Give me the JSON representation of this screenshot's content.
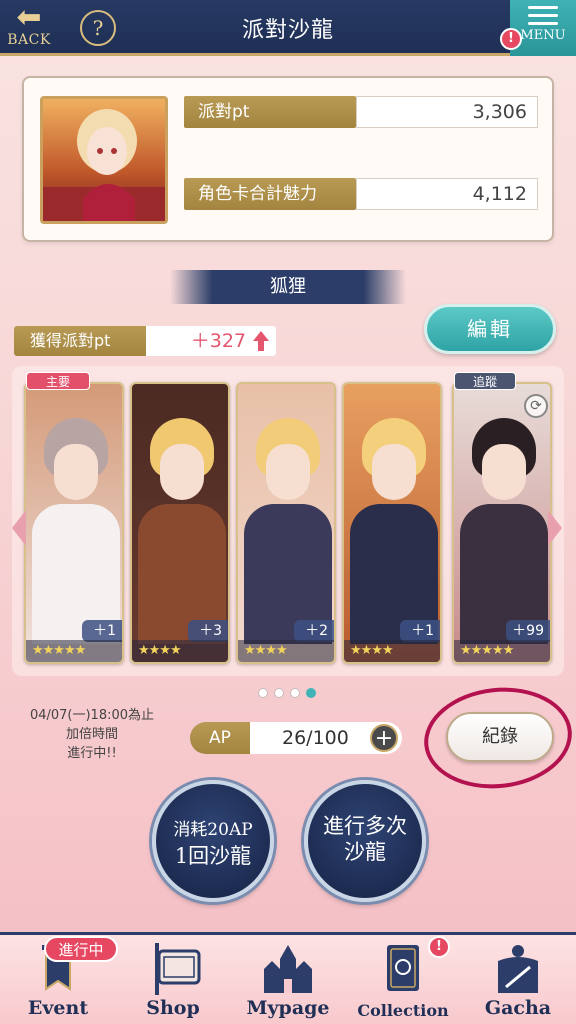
{
  "header": {
    "back_label": "BACK",
    "help_label": "?",
    "title": "派對沙龍",
    "menu_label": "MENU",
    "menu_badge": "!"
  },
  "stats": {
    "party_pt_label": "派對pt",
    "party_pt_value": "3,306",
    "charm_label": "角色卡合計魅力",
    "charm_value": "4,112"
  },
  "character_name": "狐狸",
  "edit_label": "編輯",
  "gain": {
    "label": "獲得派對pt",
    "value": "＋327"
  },
  "cards": [
    {
      "plus": "＋1",
      "stars": "★★★★★",
      "tag": "主要"
    },
    {
      "plus": "＋3",
      "stars": "★★★★"
    },
    {
      "plus": "＋2",
      "stars": "★★★★"
    },
    {
      "plus": "＋1",
      "stars": "★★★★"
    },
    {
      "plus": "＋99",
      "stars": "★★★★★",
      "tag": "追蹤"
    }
  ],
  "pager": {
    "total": 4,
    "active": 4
  },
  "event_note": {
    "line1": "04/07(一)18:00為止",
    "line2": "加倍時間",
    "line3": "進行中!!"
  },
  "ap": {
    "label": "AP",
    "value": "26/100",
    "plus": "+"
  },
  "record_label": "紀錄",
  "actions": {
    "single_line1": "消耗20AP",
    "single_line2": "1回沙龍",
    "multi_line1": "進行多次",
    "multi_line2": "沙龍"
  },
  "bottom_nav": {
    "event_tag": "進行中",
    "event": "Event",
    "shop": "Shop",
    "mypage": "Mypage",
    "collection": "Collection",
    "collection_badge": "!",
    "gacha": "Gacha"
  },
  "colors": {
    "navy": "#273a63",
    "gold": "#b89a55",
    "teal": "#3fb3b6",
    "pink_accent": "#e54860",
    "annotation_circle": "#b3124f"
  }
}
